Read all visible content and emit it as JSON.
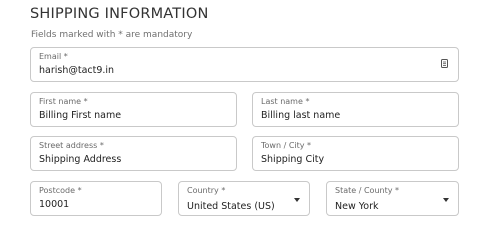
{
  "header": {
    "title": "SHIPPING INFORMATION",
    "subtitle": "Fields marked with * are mandatory"
  },
  "form": {
    "email": {
      "label": "Email *",
      "value": "harish@tact9.in",
      "icon": "contact-card-icon"
    },
    "first_name": {
      "label": "First name *",
      "value": "Billing First name"
    },
    "last_name": {
      "label": "Last name *",
      "value": "Billing last name"
    },
    "street": {
      "label": "Street address *",
      "value": "Shipping Address"
    },
    "city": {
      "label": "Town / City *",
      "value": "Shipping City"
    },
    "postcode": {
      "label": "Postcode *",
      "value": "10001"
    },
    "country": {
      "label": "Country *",
      "value": "United States (US)",
      "icon": "chevron-down-icon"
    },
    "state": {
      "label": "State / County *",
      "value": "New York",
      "icon": "chevron-down-icon"
    }
  }
}
